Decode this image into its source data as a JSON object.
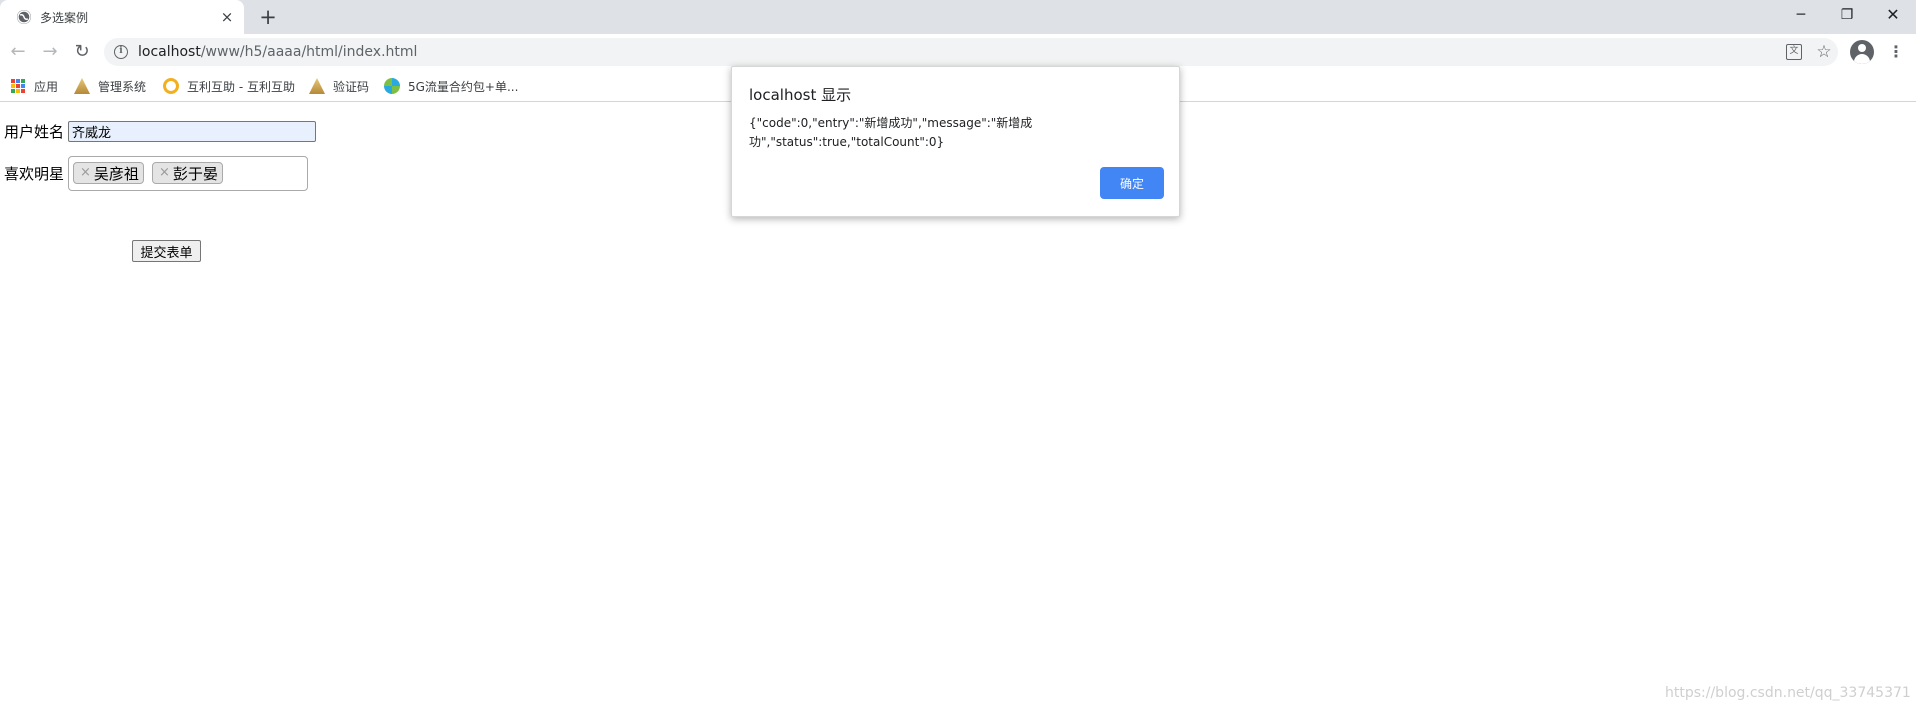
{
  "browser": {
    "tab": {
      "title": "多选案例",
      "close": "×"
    },
    "newtab": "+",
    "window": {
      "minimize": "─",
      "maximize": "❐",
      "close": "✕"
    },
    "nav": {
      "back": "←",
      "forward": "→",
      "reload": "↻"
    },
    "address": {
      "host": "localhost",
      "path": "/www/h5/aaaa/html/index.html"
    },
    "translate_glyph": "文",
    "star_glyph": "☆",
    "menu_glyph": "⋮"
  },
  "bookmarks": [
    {
      "label": "应用",
      "icon": "apps-grid-icon"
    },
    {
      "label": "管理系统",
      "icon": "bookmark-doc-icon"
    },
    {
      "label": "互利互助 - 互利互助",
      "icon": "swirl-icon"
    },
    {
      "label": "验证码",
      "icon": "bookmark-doc-icon"
    },
    {
      "label": "5G流量合约包+单...",
      "icon": "globe-icon"
    }
  ],
  "apps_colors": [
    "#ea4335",
    "#4285f4",
    "#34a853",
    "#fbbc05",
    "#ea4335",
    "#4285f4",
    "#34a853",
    "#fbbc05",
    "#ea4335"
  ],
  "form": {
    "name_label": "用户姓名",
    "name_value": "齐威龙",
    "stars_label": "喜欢明星",
    "chips": [
      {
        "x": "×",
        "label": "吴彦祖"
      },
      {
        "x": "×",
        "label": "彭于晏"
      }
    ],
    "submit_label": "提交表单"
  },
  "dialog": {
    "title": "localhost 显示",
    "message": "{\"code\":0,\"entry\":\"新增成功\",\"message\":\"新增成功\",\"status\":true,\"totalCount\":0}",
    "ok_label": "确定"
  },
  "watermark": "https://blog.csdn.net/qq_33745371"
}
